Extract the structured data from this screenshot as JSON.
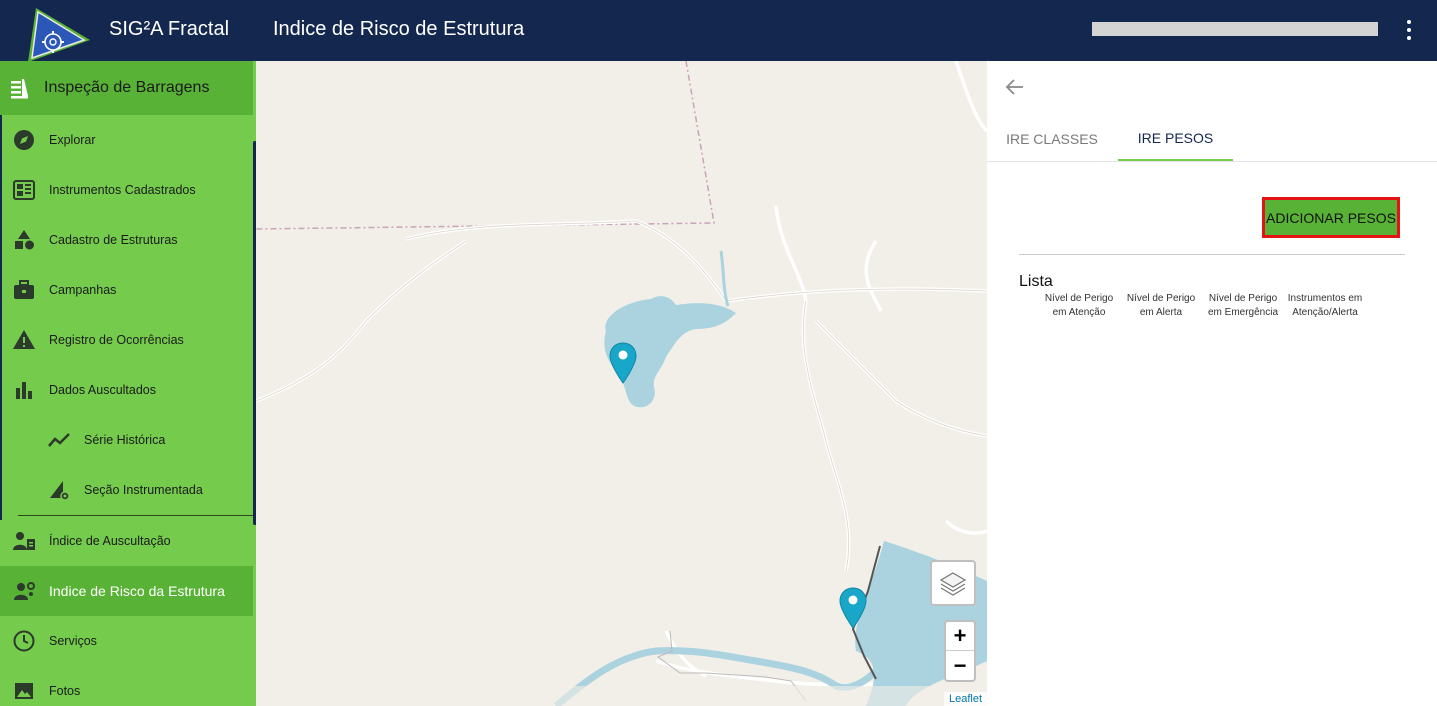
{
  "header": {
    "app_title": "SIG²A Fractal",
    "page_title": "Indice de Risco de Estrutura",
    "brand_color": "#14284f",
    "logo_icon": "gear-triangle-logo-icon",
    "menu_icon": "more-vert-icon"
  },
  "sidebar": {
    "title": "Inspeção de Barragens",
    "accent": "#74cb4c",
    "active_color": "#58b236",
    "items": [
      {
        "label": "Explorar",
        "icon": "compass-icon"
      },
      {
        "label": "Instrumentos Cadastrados",
        "icon": "dashboard-icon"
      },
      {
        "label": "Cadastro de Estruturas",
        "icon": "shapes-icon"
      },
      {
        "label": "Campanhas",
        "icon": "briefcase-icon"
      },
      {
        "label": "Registro de Ocorrências",
        "icon": "warning-icon"
      },
      {
        "label": "Dados Auscultados",
        "icon": "bar-chart-icon"
      },
      {
        "label": "Série Histórica",
        "icon": "trend-line-icon"
      },
      {
        "label": "Seção Instrumentada",
        "icon": "section-gear-icon"
      },
      {
        "label": "Índice de Auscultação",
        "icon": "person-clipboard-icon"
      },
      {
        "label": "Indice de Risco da Estrutura",
        "icon": "person-gear-icon"
      },
      {
        "label": "Serviços",
        "icon": "clock-icon"
      },
      {
        "label": "Fotos",
        "icon": "photo-icon"
      }
    ]
  },
  "map": {
    "attribution": "Leaflet",
    "zoom_in": "+",
    "zoom_out": "−",
    "layers_icon": "layers-icon",
    "marker_color": "#19a7c9",
    "water_color": "#aad3df"
  },
  "panel": {
    "tabs": [
      {
        "label": "IRE CLASSES"
      },
      {
        "label": "IRE PESOS"
      }
    ],
    "add_button": "ADICIONAR PESOS",
    "list_title": "Lista",
    "columns": [
      {
        "line1": "Nível de Perigo",
        "line2": "em Atenção"
      },
      {
        "line1": "Nível de Perigo",
        "line2": "em Alerta"
      },
      {
        "line1": "Nível de Perigo",
        "line2": "em Emergência"
      },
      {
        "line1": "Instrumentos em",
        "line2": "Atenção/Alerta"
      }
    ]
  }
}
